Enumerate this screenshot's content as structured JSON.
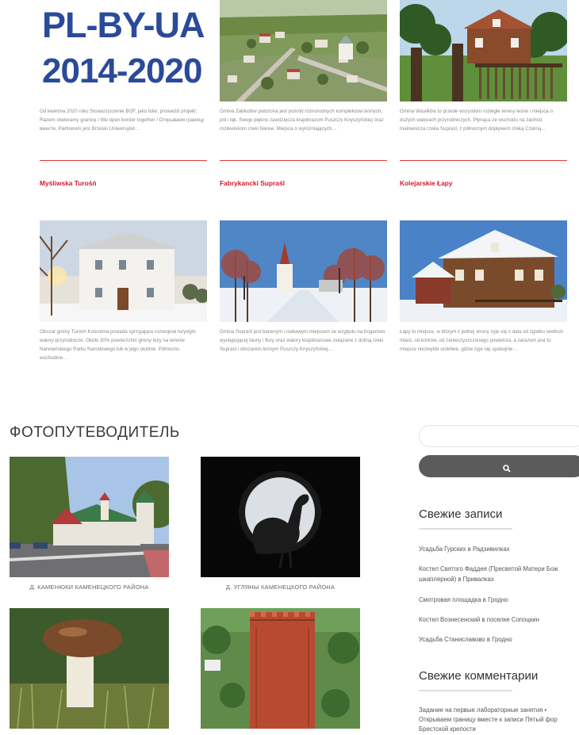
{
  "top_section": {
    "logo": {
      "line1": "PL-BY-UA",
      "line2": "2014-2020"
    },
    "cards_row1": [
      {
        "desc": "Od kwietnia 2020 roku Stowarzyszenie BOF, jako lider, prowadzi projekt: Razem otwieramy granicę / We open border together / Открываем границу вместе. Partnerem jest Brzeski Uniwersytet…",
        "category": "Myśliwska Turośń"
      },
      {
        "desc": "Gmina Zabłudów położona jest pośród różnorodnych kompleksów leśnych, pól i łąk. Swoje piękno zawdzięcza krajobrazom Puszczy Knyszyńskiej oraz rozlewiskom rzeki Narew. Miejsca o wyróżniających…",
        "category": "Fabrykancki Supraśl"
      },
      {
        "desc": "Gmina Wasilków to przede wszystkim rozległe tereny leśne i miejsca o dużych walorach przyrodniczych. Płynąca ze wschodu na zachód malownicza rzeka Supraśl, z północnym dopływem rzeką Czarną…",
        "category": "Kolejarskie Łapy"
      }
    ],
    "cards_row2": [
      {
        "desc": "Obszar gminy Turośń Kościelna posiada sprzyjające rozwojowi turystyki walory przyrodnicze. Około 30% powierzchni gminy leży na terenie Narwiańskiego Parku Narodowego lub w jego otulinie. Północno-wschodnie…"
      },
      {
        "desc": "Gmina Supraśl jest barwnym i ciekawym miejscem ze względu na bogactwo występującej fauny i flory oraz walory krajobrazowe związane z doliną rzeki Supraśl i obszarem leśnym Puszczy Knyszyńskiej…"
      },
      {
        "desc": "Łapy to miejsce, w którym z jednej strony żyje się z dala od zgiełku wielkich miast, od korków, od zanieczyszczonego powietrza, a zarazem jest to miejsce niezwykle urokliwe, gdzie żyje się spokojnie…"
      }
    ]
  },
  "photoguide": {
    "title": "ФОТОПУТЕВОДИТЕЛЬ",
    "items": [
      {
        "caption": "Д. КАМЕНЮКИ КАМЕНЕЦКОГО РАЙОНА"
      },
      {
        "caption": "Д. УГЛЯНЫ КАМЕНЕЦКОГО РАЙОНА"
      },
      {
        "caption": ""
      },
      {
        "caption": ""
      }
    ]
  },
  "sidebar": {
    "search": {
      "placeholder": "",
      "button_icon": "search-icon"
    },
    "recent_posts": {
      "title": "Свежие записи",
      "items": [
        "Усадьба Гурских в Радзивилках",
        "Костел Святого Фаддея (Пресвятой Матери Бож",
        "шкаплерной) в Привалках",
        "Смотровая площадка в Гродно",
        "Костел Вознесенский в поселке Сопоцкин",
        "Усадьба Станиславово в Гродно"
      ]
    },
    "recent_comments": {
      "title": "Свежие комментарии",
      "lines": [
        "Задание на первые лабораторные занятия •",
        "Открываем границу вместе к записи Пятый фор",
        "Брестской крепости"
      ]
    }
  },
  "colors": {
    "accent": "#d4192c",
    "logo_blue": "#2a4a9a",
    "button": "#5b5b5b"
  }
}
